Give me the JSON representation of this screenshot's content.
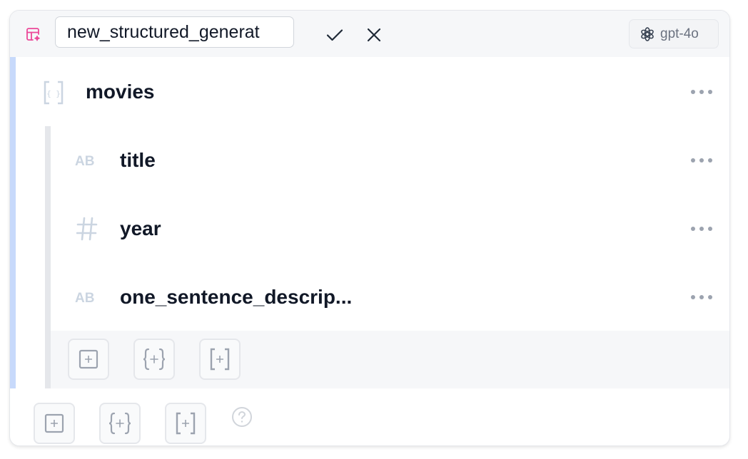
{
  "header": {
    "schema_name_value": "new_structured_generat",
    "model_label": "gpt-4o",
    "icons": {
      "schema": "table-sparkle-icon",
      "confirm": "check-icon",
      "cancel": "close-icon",
      "model": "openai-logo-icon"
    }
  },
  "schema": {
    "root": {
      "name": "movies",
      "type": "array",
      "icon": "array-brackets-icon"
    },
    "fields": [
      {
        "name": "title",
        "type": "string",
        "icon": "text-ab-icon"
      },
      {
        "name": "year",
        "type": "number",
        "icon": "hash-icon"
      },
      {
        "name": "one_sentence_descrip...",
        "type": "string",
        "icon": "text-ab-icon"
      }
    ]
  },
  "actions": {
    "nested": [
      "add-field-icon",
      "add-object-icon",
      "add-array-icon"
    ],
    "root": [
      "add-field-icon",
      "add-object-icon",
      "add-array-icon",
      "help-icon"
    ]
  },
  "colors": {
    "accent_pink": "#ec4899",
    "left_rail": "#c7d9fb",
    "header_bg": "#f6f7f9",
    "icon_gray": "#9ca3af"
  }
}
